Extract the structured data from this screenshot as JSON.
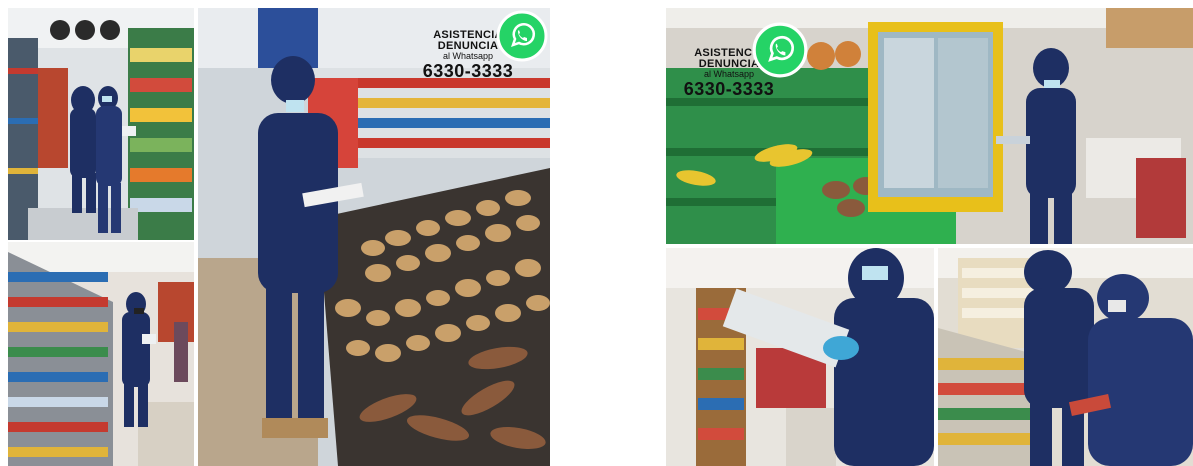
{
  "badge": {
    "line1": "ASISTENCIA",
    "line2": "DENUNCIA",
    "line3": "al Whatsapp",
    "phone": "6330-3333"
  },
  "icons": {
    "whatsapp": "whatsapp-icon",
    "whatsapp_color": "#25d366"
  },
  "colors": {
    "coverall": "#1e2f63",
    "shelf_green": "#2f8f4a",
    "potato": "#c9a06a",
    "yellow_fridge": "#e8c01a"
  }
}
